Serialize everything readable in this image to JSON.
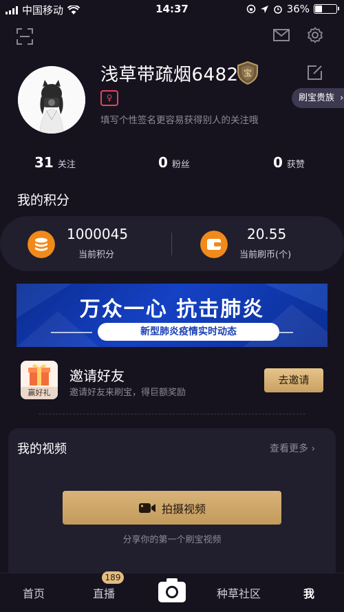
{
  "status_bar": {
    "carrier": "中国移动",
    "time": "14:37",
    "battery": "36%",
    "battery_level": 0.36
  },
  "profile": {
    "username": "浅草带疏烟6482",
    "badge_char": "宝",
    "gender_symbol": "♀",
    "signature": "填写个性签名更容易获得别人的关注哦",
    "vip_label": "刷宝贵族"
  },
  "stats": [
    {
      "value": "31",
      "label": "关注"
    },
    {
      "value": "0",
      "label": "粉丝"
    },
    {
      "value": "0",
      "label": "获赞"
    }
  ],
  "points": {
    "title": "我的积分",
    "score_value": "1000045",
    "score_label": "当前积分",
    "coin_value": "20.55",
    "coin_label": "当前刷币(个)"
  },
  "banner": {
    "title": "万众一心 抗击肺炎",
    "subtitle": "新型肺炎疫情实时动态"
  },
  "invite": {
    "icon_tag": "赢好礼",
    "title": "邀请好友",
    "subtitle": "邀请好友来刷宝，得巨额奖励",
    "button": "去邀请"
  },
  "videos": {
    "title": "我的视频",
    "more": "查看更多",
    "shoot_button": "拍摄视频",
    "hint": "分享你的第一个刷宝视频"
  },
  "nav": {
    "home": "首页",
    "live": "直播",
    "live_badge": "189",
    "community": "种草社区",
    "me": "我"
  },
  "colors": {
    "background": "#16131f",
    "card": "#211e2d",
    "accent_gold": "#d9b378",
    "coin_orange": "#f08a1a"
  }
}
